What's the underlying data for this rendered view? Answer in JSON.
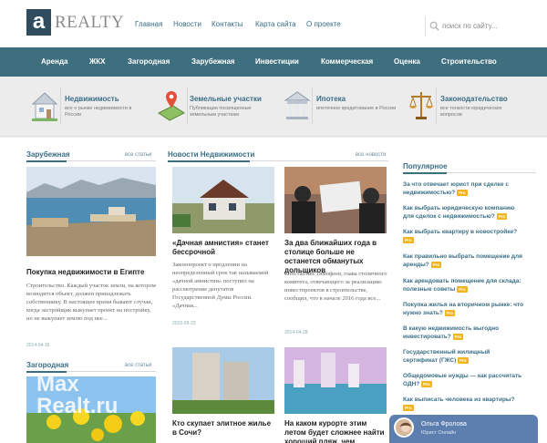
{
  "logo": {
    "letter": "a",
    "text": "REALTY"
  },
  "topnav": [
    "Главная",
    "Новости",
    "Контакты",
    "Карта сайта",
    "О проекте"
  ],
  "search": {
    "placeholder": "поиск по сайту..."
  },
  "mainnav": [
    "Аренда",
    "ЖКХ",
    "Загородная",
    "Зарубежная",
    "Инвестиции",
    "Коммерческая",
    "Оценка",
    "Строительство"
  ],
  "features": [
    {
      "title": "Недвижимость",
      "desc": "все о рынке недвижимости в России"
    },
    {
      "title": "Земельные участки",
      "desc": "Публикации посвященные земельным участкам"
    },
    {
      "title": "Ипотека",
      "desc": "ипотечное кредитование в России"
    },
    {
      "title": "Законодательство",
      "desc": "все тонкости юридических вопросов"
    }
  ],
  "left": {
    "section1": {
      "title": "Зарубежная",
      "link": "все статьи"
    },
    "article": {
      "title": "Покупка недвижимости в Египте",
      "text": "Строительство. Каждый участок земли, на котором возводится объект, должен принадлежать собственнику. В настоящее время бывают случаи, когда застройщик выкупает проект на постройку, но не выкупает землю под нее...",
      "date": "2014-04-16"
    },
    "section2": {
      "title": "Загородная",
      "link": "все статьи"
    },
    "watermark": [
      "Max",
      "Realt.ru"
    ]
  },
  "middle": {
    "section": {
      "title": "Новости Недвижимости",
      "link": "все новости"
    },
    "articles": [
      {
        "title": "«Дачная амнистия» станет бессрочной",
        "text": "Законопроект о продлении на неопределенный срок так называемой «дачной амнистии» поступил на рассмотрение депутатов Государственной Думы России. «Дачная...",
        "date": "2015-09-23"
      },
      {
        "title": "За два ближайших года в столице больше не останется обманутых дольщиков",
        "text": "Константин Тимофеев, глава столичного комитета, отвечающего за реализацию инвестпроектов в строительстве, сообщил, что в начале 2016 года все...",
        "date": "2014-04-28"
      },
      {
        "title": "Кто скупает элитное жилье в Сочи?"
      },
      {
        "title": "На каком курорте этим летом будет сложнее найти хороший пляж, чем хорошую"
      }
    ]
  },
  "popular": {
    "title": "Популярное",
    "badge": "Pro",
    "items": [
      "За что отвечает юрист при сделке с недвижимостью?",
      "Как выбрать юридическую компанию для сделок с недвижимостью?",
      "Как выбрать квартиру в новостройке?",
      "Как правильно выбрать помещение для аренды?",
      "Как арендовать помещение для склада: полезные советы",
      "Покупка жилья на вторичном рынке: что нужно знать?",
      "В какую недвижимость выгодно инвестировать?",
      "Государственный жилищный сертификат (ГЖС)",
      "Общедомовые нужды — как рассчитать ОДН?",
      "Как выписать человека из квартиры?"
    ]
  },
  "chat": {
    "name": "Ольга Фролова",
    "role": "Юрист Онлайн"
  },
  "colors": {
    "brand": "#3d6f7e",
    "link": "#3a6e86",
    "badge": "#f3b51f",
    "chat": "#5d7fb0"
  }
}
